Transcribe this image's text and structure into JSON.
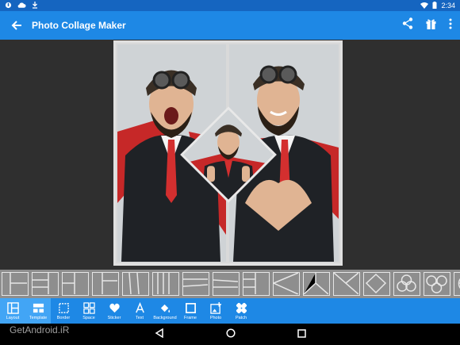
{
  "status": {
    "time": "2:34"
  },
  "app": {
    "title": "Photo Collage Maker"
  },
  "tools": [
    {
      "label": "Layout"
    },
    {
      "label": "Template"
    },
    {
      "label": "Border"
    },
    {
      "label": "Space"
    },
    {
      "label": "Sticker"
    },
    {
      "label": "Text"
    },
    {
      "label": "Background"
    },
    {
      "label": "Frame"
    },
    {
      "label": "Photo"
    },
    {
      "label": "Patch"
    }
  ],
  "watermark": "GetAndroid.iR",
  "colors": {
    "primary": "#1e88e5",
    "primary_dark": "#1565c0",
    "active_tool": "#42a5f5"
  }
}
